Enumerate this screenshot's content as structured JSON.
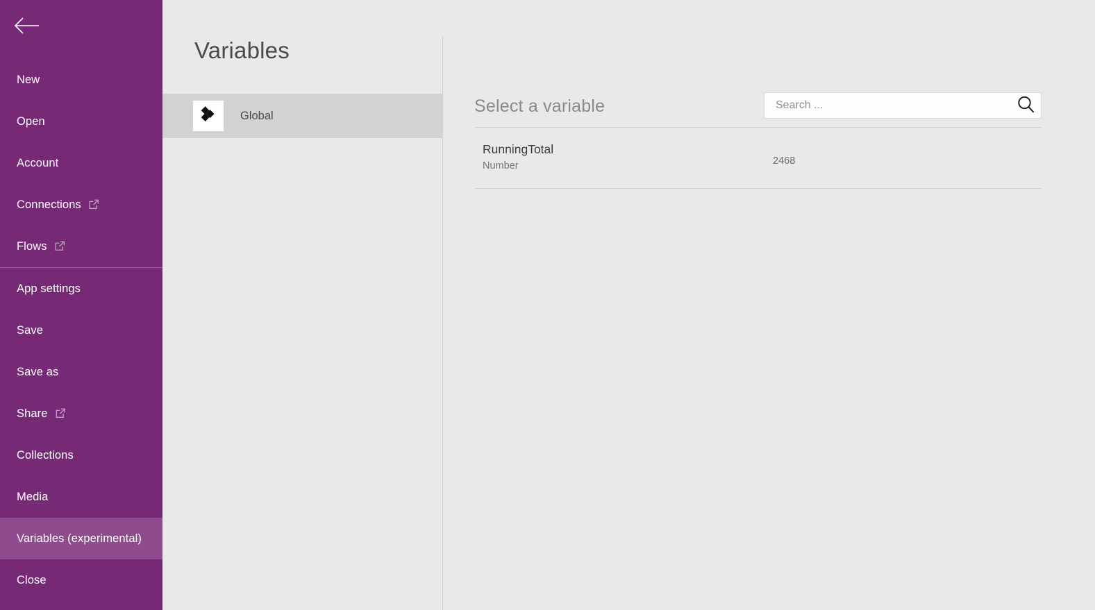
{
  "colors": {
    "sidebar_bg": "#762a76",
    "sidebar_selected": "#8e4b8e",
    "sidebar_divider": "#9a5f9a",
    "panel_bg": "#e9e9e9",
    "row_selected": "#d2d2d2",
    "rule": "#d2d2d2",
    "text_dark": "#3c3c3c",
    "text_muted": "#767676",
    "search_bg": "#fdfdfd",
    "search_border": "#d8d8d8"
  },
  "sidebar": {
    "back_icon": "arrow-left-icon",
    "items": [
      {
        "label": "New",
        "icon": null,
        "selected": false,
        "separator_after": false
      },
      {
        "label": "Open",
        "icon": null,
        "selected": false,
        "separator_after": false
      },
      {
        "label": "Account",
        "icon": null,
        "selected": false,
        "separator_after": false
      },
      {
        "label": "Connections",
        "icon": "external-link-icon",
        "selected": false,
        "separator_after": false
      },
      {
        "label": "Flows",
        "icon": "external-link-icon",
        "selected": false,
        "separator_after": true
      },
      {
        "label": "App settings",
        "icon": null,
        "selected": false,
        "separator_after": false
      },
      {
        "label": "Save",
        "icon": null,
        "selected": false,
        "separator_after": false
      },
      {
        "label": "Save as",
        "icon": null,
        "selected": false,
        "separator_after": false
      },
      {
        "label": "Share",
        "icon": "external-link-icon",
        "selected": false,
        "separator_after": false
      },
      {
        "label": "Collections",
        "icon": null,
        "selected": false,
        "separator_after": false
      },
      {
        "label": "Media",
        "icon": null,
        "selected": false,
        "separator_after": false
      },
      {
        "label": "Variables (experimental)",
        "icon": null,
        "selected": true,
        "separator_after": false
      },
      {
        "label": "Close",
        "icon": null,
        "selected": false,
        "separator_after": false
      }
    ]
  },
  "panel": {
    "title": "Variables",
    "sources": [
      {
        "label": "Global",
        "icon": "diamonds-icon",
        "selected": true
      }
    ]
  },
  "content": {
    "heading": "Select a variable",
    "search": {
      "placeholder": "Search ...",
      "value": "",
      "icon": "search-icon"
    },
    "variables": [
      {
        "name": "RunningTotal",
        "type": "Number",
        "value": "2468"
      }
    ]
  }
}
